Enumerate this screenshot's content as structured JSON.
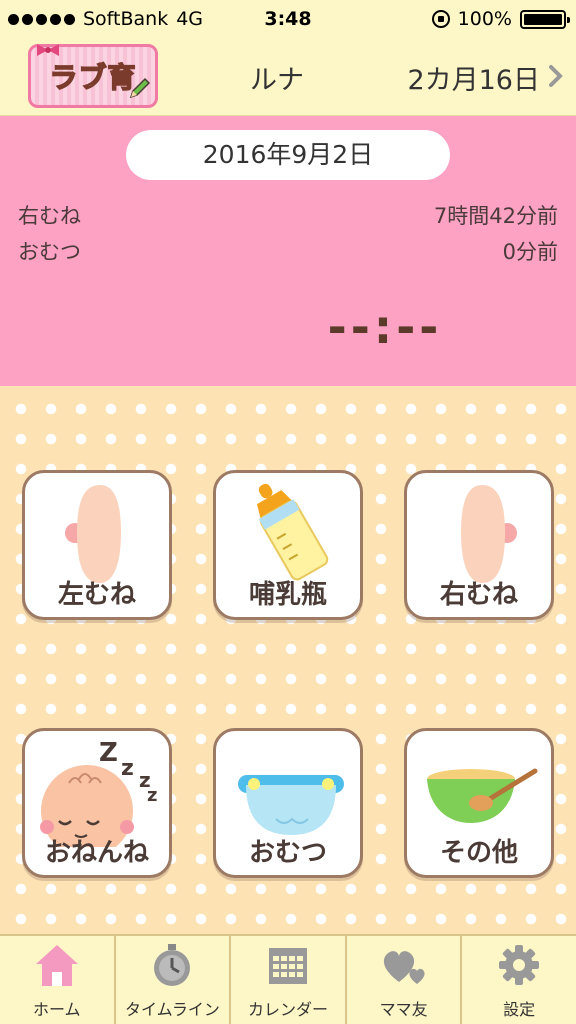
{
  "status_bar": {
    "carrier": "SoftBank",
    "network": "4G",
    "time": "3:48",
    "battery": "100%"
  },
  "header": {
    "logo_text": "ラブ育",
    "baby_name": "ルナ",
    "age": "2カ月16日"
  },
  "summary": {
    "date": "2016年9月2日",
    "rows": [
      {
        "label": "右むね",
        "value": "7時間42分前"
      },
      {
        "label": "おむつ",
        "value": "0分前"
      }
    ],
    "timer": "--:--"
  },
  "actions": [
    {
      "label": "左むね",
      "icon": "left-breast-icon"
    },
    {
      "label": "哺乳瓶",
      "icon": "baby-bottle-icon"
    },
    {
      "label": "右むね",
      "icon": "right-breast-icon"
    },
    {
      "label": "おねんね",
      "icon": "sleeping-baby-icon"
    },
    {
      "label": "おむつ",
      "icon": "diaper-icon"
    },
    {
      "label": "その他",
      "icon": "food-bowl-icon"
    }
  ],
  "tabs": [
    {
      "label": "ホーム",
      "icon": "home-icon"
    },
    {
      "label": "タイムライン",
      "icon": "stopwatch-icon"
    },
    {
      "label": "カレンダー",
      "icon": "calendar-icon"
    },
    {
      "label": "ママ友",
      "icon": "hearts-icon"
    },
    {
      "label": "設定",
      "icon": "gear-icon"
    }
  ],
  "colors": {
    "header_bg": "#fdf6c7",
    "panel_pink": "#fea2c4",
    "dotted_bg": "#fde2b4",
    "button_border": "#9c7a64",
    "active_tab": "#f49ac0"
  }
}
